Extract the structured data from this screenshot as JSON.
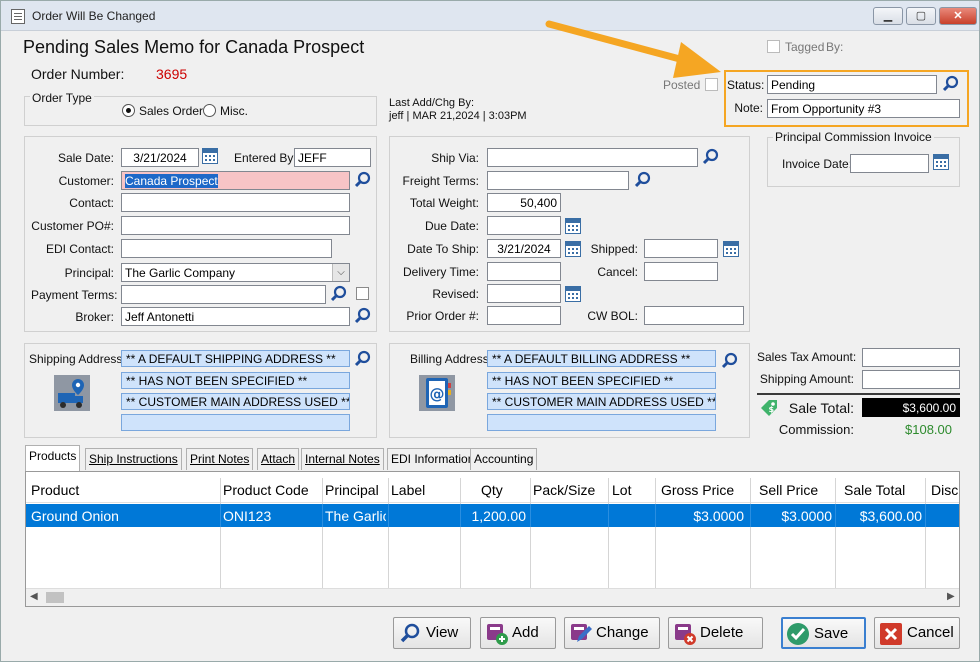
{
  "window": {
    "title": "Order Will Be Changed"
  },
  "header": {
    "memo_title": "Pending Sales Memo for Canada Prospect",
    "order_number_label": "Order Number:",
    "order_number": "3695"
  },
  "tagged": {
    "label": "Tagged",
    "by_label": "By:"
  },
  "posted": {
    "label": "Posted"
  },
  "status": {
    "label": "Status:",
    "value": "Pending"
  },
  "note": {
    "label": "Note:",
    "value": "From Opportunity #3"
  },
  "order_type": {
    "title": "Order Type",
    "opt_sales": "Sales Order",
    "opt_misc": "Misc."
  },
  "last_add": {
    "label": "Last Add/Chg By:",
    "value": "jeff | MAR 21,2024 |  3:03PM"
  },
  "commission_invoice": {
    "title": "Principal Commission Invoice",
    "invoice_date_label": "Invoice Date:",
    "invoice_date": ""
  },
  "left_form": {
    "sale_date_label": "Sale Date:",
    "sale_date": "3/21/2024",
    "entered_by_label": "Entered By:",
    "entered_by": "JEFF",
    "customer_label": "Customer:",
    "customer": "Canada Prospect",
    "contact_label": "Contact:",
    "contact": "",
    "customer_po_label": "Customer PO#:",
    "customer_po": "",
    "edi_contact_label": "EDI Contact:",
    "edi_contact": "",
    "principal_label": "Principal:",
    "principal": "The Garlic Company",
    "payment_terms_label": "Payment Terms:",
    "payment_terms": "",
    "broker_label": "Broker:",
    "broker": "Jeff Antonetti"
  },
  "mid_form": {
    "ship_via_label": "Ship Via:",
    "ship_via": "",
    "freight_terms_label": "Freight Terms:",
    "freight_terms": "",
    "total_weight_label": "Total Weight:",
    "total_weight": "50,400",
    "due_date_label": "Due Date:",
    "due_date": "",
    "date_to_ship_label": "Date To Ship:",
    "date_to_ship": "3/21/2024",
    "shipped_label": "Shipped:",
    "shipped": "",
    "delivery_time_label": "Delivery Time:",
    "delivery_time": "",
    "cancel_label": "Cancel:",
    "cancel": "",
    "revised_label": "Revised:",
    "revised": "",
    "prior_order_label": "Prior Order #:",
    "prior_order": "",
    "cw_bol_label": "CW BOL:",
    "cw_bol": ""
  },
  "shipping": {
    "label": "Shipping Address:",
    "lines": [
      "** A DEFAULT SHIPPING ADDRESS **",
      "** HAS NOT BEEN SPECIFIED **",
      "** CUSTOMER MAIN ADDRESS USED **",
      ""
    ]
  },
  "billing": {
    "label": "Billing Address:",
    "lines": [
      "** A DEFAULT BILLING ADDRESS **",
      "** HAS NOT BEEN SPECIFIED **",
      "** CUSTOMER MAIN ADDRESS USED **",
      ""
    ]
  },
  "totals": {
    "sales_tax_label": "Sales Tax Amount:",
    "sales_tax": "",
    "shipping_label": "Shipping Amount:",
    "shipping": "",
    "sale_total_label": "Sale Total:",
    "sale_total": "$3,600.00",
    "commission_label": "Commission:",
    "commission": "$108.00"
  },
  "tabs": [
    "Products",
    "Ship Instructions",
    "Print Notes",
    "Attach",
    "Internal Notes",
    "EDI Information",
    "Accounting"
  ],
  "grid": {
    "columns": [
      "Product",
      "Product Code",
      "Principal",
      "Label",
      "Qty",
      "Pack/Size",
      "Lot",
      "Gross Price",
      "Sell Price",
      "Sale Total",
      "Disc"
    ],
    "rows": [
      [
        "Ground Onion",
        "ONI123",
        "The Garlic",
        "",
        "1,200.00",
        "",
        "",
        "$3.0000",
        "$3.0000",
        "$3,600.00",
        ""
      ]
    ]
  },
  "buttons": {
    "view": "View",
    "add": "Add",
    "change": "Change",
    "delete": "Delete",
    "save": "Save",
    "cancel": "Cancel"
  },
  "colors": {
    "order_number": "#cc0000",
    "highlight": "#f5a623",
    "selection": "#0078d7",
    "commission": "#2e8b2e"
  }
}
